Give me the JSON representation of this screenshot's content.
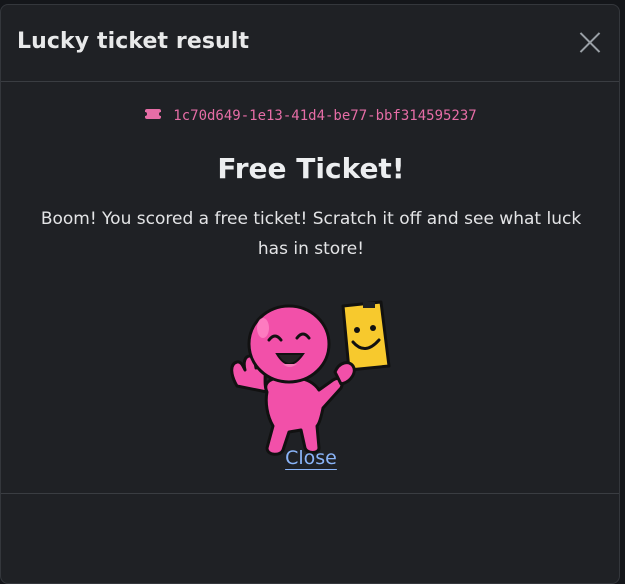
{
  "dialog": {
    "title": "Lucky ticket result",
    "close_icon": "close-icon"
  },
  "ticket": {
    "icon": "ticket-icon",
    "id": "1c70d649-1e13-41d4-be77-bbf314595237",
    "accent_color": "#e66da6"
  },
  "result": {
    "title": "Free Ticket!",
    "message": "Boom! You scored a free ticket! Scratch it off and see what luck has in store!"
  },
  "illustration": {
    "name": "pink-character-holding-ticket"
  },
  "footer": {
    "close_label": "Close",
    "link_color": "#8ab4f8"
  }
}
